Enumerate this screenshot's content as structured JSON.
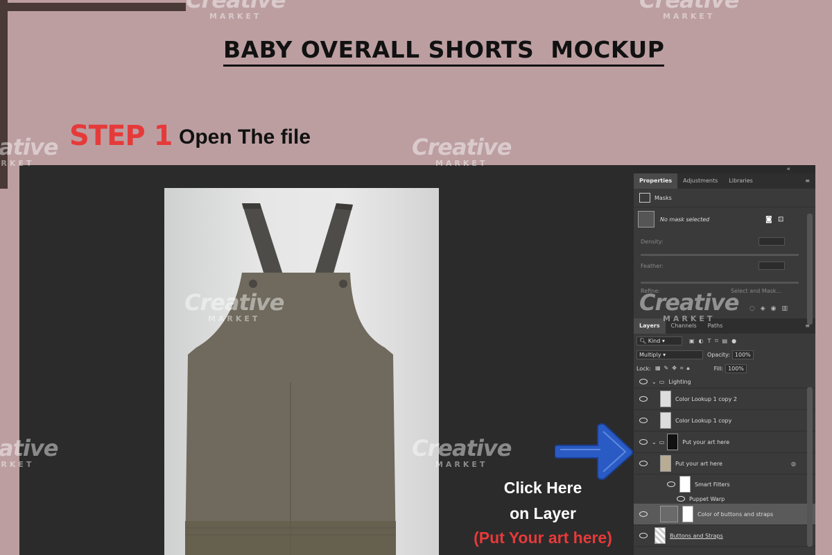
{
  "header": {
    "title": "BABY OVERALL SHORTS  MOCKUP",
    "step_label": "STEP 1",
    "step_desc": "Open The file"
  },
  "watermark": {
    "text": "Creative",
    "sub": "MARKET"
  },
  "callout": {
    "line1": "Click Here",
    "line2": "on Layer",
    "line3": "(Put Your art here)",
    "arrow_color": "#2a5bc4"
  },
  "properties_panel": {
    "tabs": [
      "Properties",
      "Adjustments",
      "Libraries"
    ],
    "section": "Masks",
    "mask_status": "No mask selected",
    "density_label": "Density:",
    "feather_label": "Feather:",
    "refine_label": "Refine:",
    "select_mask_button": "Select and Mask..."
  },
  "layers_panel": {
    "tabs": [
      "Layers",
      "Channels",
      "Paths"
    ],
    "filter_kind": "Kind",
    "blend_mode": "Multiply",
    "opacity_label": "Opacity:",
    "opacity_value": "100%",
    "lock_label": "Lock:",
    "fill_label": "Fill:",
    "fill_value": "100%",
    "layers": [
      "Lighting",
      "Color Lookup 1 copy 2",
      "Color Lookup 1 copy",
      "Put your art here",
      "Put your art here",
      "Smart Filters",
      "Puppet Warp",
      "Color of buttons and straps",
      "Buttons and Straps"
    ]
  },
  "colors": {
    "background": "#bc9ea1",
    "accent_red": "#e63a3a",
    "garment": "#6f6a5d",
    "straps": "#4d4c48"
  }
}
